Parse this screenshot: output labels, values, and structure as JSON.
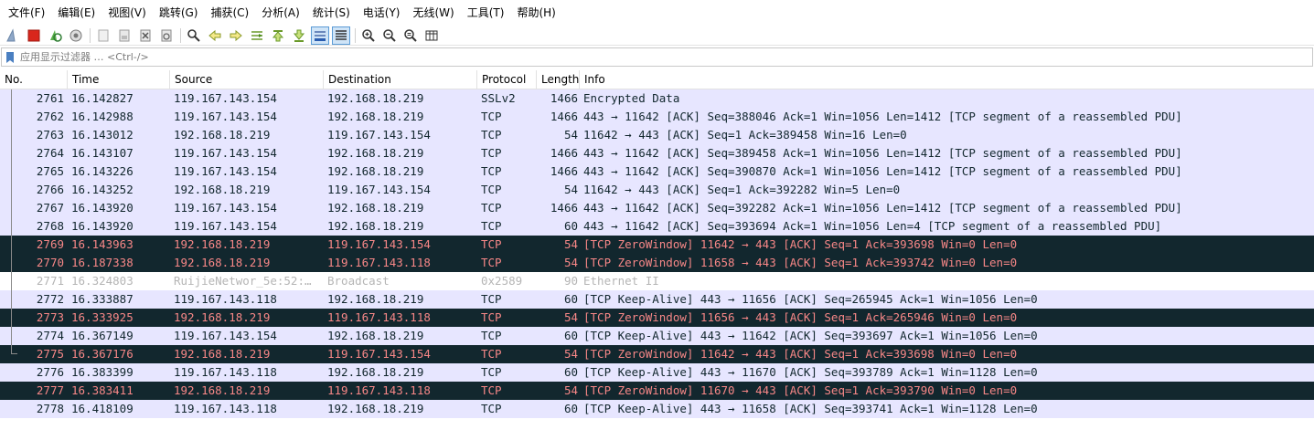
{
  "menu": [
    "文件(F)",
    "编辑(E)",
    "视图(V)",
    "跳转(G)",
    "捕获(C)",
    "分析(A)",
    "统计(S)",
    "电话(Y)",
    "无线(W)",
    "工具(T)",
    "帮助(H)"
  ],
  "toolbar": {
    "icons": [
      "shark-fin-start-icon",
      "stop-capture-icon",
      "restart-capture-icon",
      "capture-options-icon",
      "open-file-icon",
      "save-file-icon",
      "close-file-icon",
      "reload-file-icon",
      "find-packet-icon",
      "go-back-icon",
      "go-forward-icon",
      "go-to-packet-icon",
      "go-first-icon",
      "go-last-icon",
      "autoscroll-icon",
      "colorize-icon",
      "zoom-in-icon",
      "zoom-out-icon",
      "zoom-normal-icon",
      "resize-columns-icon"
    ]
  },
  "filter": {
    "placeholder": "应用显示过滤器 … <Ctrl-/>"
  },
  "columns": [
    "No.",
    "Time",
    "Source",
    "Destination",
    "Protocol",
    "Length",
    "Info"
  ],
  "packets": [
    {
      "no": "2761",
      "time": "16.142827",
      "src": "119.167.143.154",
      "dst": "192.168.18.219",
      "proto": "SSLv2",
      "len": "1466",
      "info": "Encrypted Data",
      "style": "tcp"
    },
    {
      "no": "2762",
      "time": "16.142988",
      "src": "119.167.143.154",
      "dst": "192.168.18.219",
      "proto": "TCP",
      "len": "1466",
      "info": "443 → 11642 [ACK] Seq=388046 Ack=1 Win=1056 Len=1412 [TCP segment of a reassembled PDU]",
      "style": "tcp"
    },
    {
      "no": "2763",
      "time": "16.143012",
      "src": "192.168.18.219",
      "dst": "119.167.143.154",
      "proto": "TCP",
      "len": "54",
      "info": "11642 → 443 [ACK] Seq=1 Ack=389458 Win=16 Len=0",
      "style": "tcp"
    },
    {
      "no": "2764",
      "time": "16.143107",
      "src": "119.167.143.154",
      "dst": "192.168.18.219",
      "proto": "TCP",
      "len": "1466",
      "info": "443 → 11642 [ACK] Seq=389458 Ack=1 Win=1056 Len=1412 [TCP segment of a reassembled PDU]",
      "style": "tcp"
    },
    {
      "no": "2765",
      "time": "16.143226",
      "src": "119.167.143.154",
      "dst": "192.168.18.219",
      "proto": "TCP",
      "len": "1466",
      "info": "443 → 11642 [ACK] Seq=390870 Ack=1 Win=1056 Len=1412 [TCP segment of a reassembled PDU]",
      "style": "tcp"
    },
    {
      "no": "2766",
      "time": "16.143252",
      "src": "192.168.18.219",
      "dst": "119.167.143.154",
      "proto": "TCP",
      "len": "54",
      "info": "11642 → 443 [ACK] Seq=1 Ack=392282 Win=5 Len=0",
      "style": "tcp"
    },
    {
      "no": "2767",
      "time": "16.143920",
      "src": "119.167.143.154",
      "dst": "192.168.18.219",
      "proto": "TCP",
      "len": "1466",
      "info": "443 → 11642 [ACK] Seq=392282 Ack=1 Win=1056 Len=1412 [TCP segment of a reassembled PDU]",
      "style": "tcp"
    },
    {
      "no": "2768",
      "time": "16.143920",
      "src": "119.167.143.154",
      "dst": "192.168.18.219",
      "proto": "TCP",
      "len": "60",
      "info": "443 → 11642 [ACK] Seq=393694 Ack=1 Win=1056 Len=4 [TCP segment of a reassembled PDU]",
      "style": "tcp"
    },
    {
      "no": "2769",
      "time": "16.143963",
      "src": "192.168.18.219",
      "dst": "119.167.143.154",
      "proto": "TCP",
      "len": "54",
      "info": "[TCP ZeroWindow] 11642 → 443 [ACK] Seq=1 Ack=393698 Win=0 Len=0",
      "style": "bad"
    },
    {
      "no": "2770",
      "time": "16.187338",
      "src": "192.168.18.219",
      "dst": "119.167.143.118",
      "proto": "TCP",
      "len": "54",
      "info": "[TCP ZeroWindow] 11658 → 443 [ACK] Seq=1 Ack=393742 Win=0 Len=0",
      "style": "bad"
    },
    {
      "no": "2771",
      "time": "16.324803",
      "src": "RuijieNetwor_5e:52:…",
      "dst": "Broadcast",
      "proto": "0x2589",
      "len": "90",
      "info": "Ethernet II",
      "style": "other"
    },
    {
      "no": "2772",
      "time": "16.333887",
      "src": "119.167.143.118",
      "dst": "192.168.18.219",
      "proto": "TCP",
      "len": "60",
      "info": "[TCP Keep-Alive] 443 → 11656 [ACK] Seq=265945 Ack=1 Win=1056 Len=0",
      "style": "tcp"
    },
    {
      "no": "2773",
      "time": "16.333925",
      "src": "192.168.18.219",
      "dst": "119.167.143.118",
      "proto": "TCP",
      "len": "54",
      "info": "[TCP ZeroWindow] 11656 → 443 [ACK] Seq=1 Ack=265946 Win=0 Len=0",
      "style": "bad"
    },
    {
      "no": "2774",
      "time": "16.367149",
      "src": "119.167.143.154",
      "dst": "192.168.18.219",
      "proto": "TCP",
      "len": "60",
      "info": "[TCP Keep-Alive] 443 → 11642 [ACK] Seq=393697 Ack=1 Win=1056 Len=0",
      "style": "tcp"
    },
    {
      "no": "2775",
      "time": "16.367176",
      "src": "192.168.18.219",
      "dst": "119.167.143.154",
      "proto": "TCP",
      "len": "54",
      "info": "[TCP ZeroWindow] 11642 → 443 [ACK] Seq=1 Ack=393698 Win=0 Len=0",
      "style": "bad"
    },
    {
      "no": "2776",
      "time": "16.383399",
      "src": "119.167.143.118",
      "dst": "192.168.18.219",
      "proto": "TCP",
      "len": "60",
      "info": "[TCP Keep-Alive] 443 → 11670 [ACK] Seq=393789 Ack=1 Win=1128 Len=0",
      "style": "tcp"
    },
    {
      "no": "2777",
      "time": "16.383411",
      "src": "192.168.18.219",
      "dst": "119.167.143.118",
      "proto": "TCP",
      "len": "54",
      "info": "[TCP ZeroWindow] 11670 → 443 [ACK] Seq=1 Ack=393790 Win=0 Len=0",
      "style": "bad"
    },
    {
      "no": "2778",
      "time": "16.418109",
      "src": "119.167.143.118",
      "dst": "192.168.18.219",
      "proto": "TCP",
      "len": "60",
      "info": "[TCP Keep-Alive] 443 → 11658 [ACK] Seq=393741 Ack=1 Win=1128 Len=0",
      "style": "tcp"
    }
  ],
  "colors": {
    "tcp_bg": "#e7e6ff",
    "bad_bg": "#12272e",
    "bad_fg": "#f78787",
    "other_fg": "#b5b5b5"
  }
}
